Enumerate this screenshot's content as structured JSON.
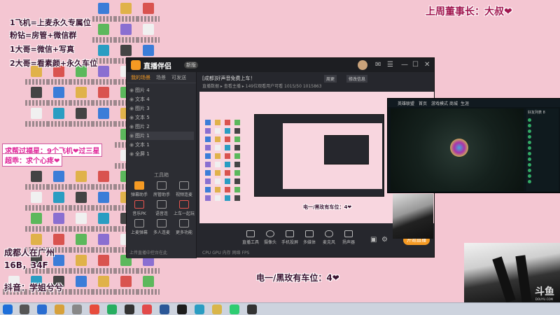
{
  "overlay": {
    "top_left_lines": [
      "1飞机=上麦永久专属位",
      "粉钻=房管+微信群",
      "1大哥=微信+写真",
      "2大哥=看素颜+永久车位"
    ],
    "top_right": "上周董事长：大叔❤",
    "request": [
      "求帮过福星：9个飞机❤过三星",
      "超乖：求个心疼❤"
    ],
    "location": [
      "成都人在广州",
      "16B，34F"
    ],
    "douyin": "抖音：学姐兮兮",
    "bottom_center": "电一/黑玫有车位：4❤"
  },
  "app": {
    "name": "直播伴侣",
    "version_tag": "新版",
    "tabs": [
      "我的场景",
      "场景",
      "可发送"
    ],
    "layers": [
      "图片 4",
      "文本 4",
      "图片 3",
      "文本 5",
      "图片 2",
      "图片 1",
      "文本 1",
      "全屏 1"
    ],
    "tools_title": "工具箱",
    "tools": [
      "弹幕助手",
      "房管助手",
      "视频连麦",
      "音乐PK",
      "语音连",
      "上车一起玩",
      "上麦弹幕",
      "多人连麦",
      "更多功能"
    ],
    "left_footer": "上传直播中控台在此",
    "room_title": "[成都]好声音免费上车！",
    "room_tag": "周更",
    "room_edit": "修改信息",
    "room_sub": "直播数据 ▸ 查看主播 ▸ 149位观看用户可看  1015/50  1015863",
    "bottom_tools": [
      "直播工具",
      "摄像头",
      "手机投屏",
      "多媒体",
      "麦克风",
      "扬声器"
    ],
    "start_button": "开始直播",
    "status_line": "CPU  GPU  内存  网络  FPS"
  },
  "game": {
    "title_items": [
      "英雄联盟",
      "首页",
      "游戏模式",
      "商城",
      "生涯"
    ],
    "side_header": "好友列表",
    "friend_count": "8"
  },
  "watermark": {
    "logo": "斗鱼",
    "sub": "DOUYU.COM"
  },
  "colors": {
    "desktop_bg": "#f4c6d2",
    "accent": "#f59a23",
    "app_bg": "#26272d"
  }
}
